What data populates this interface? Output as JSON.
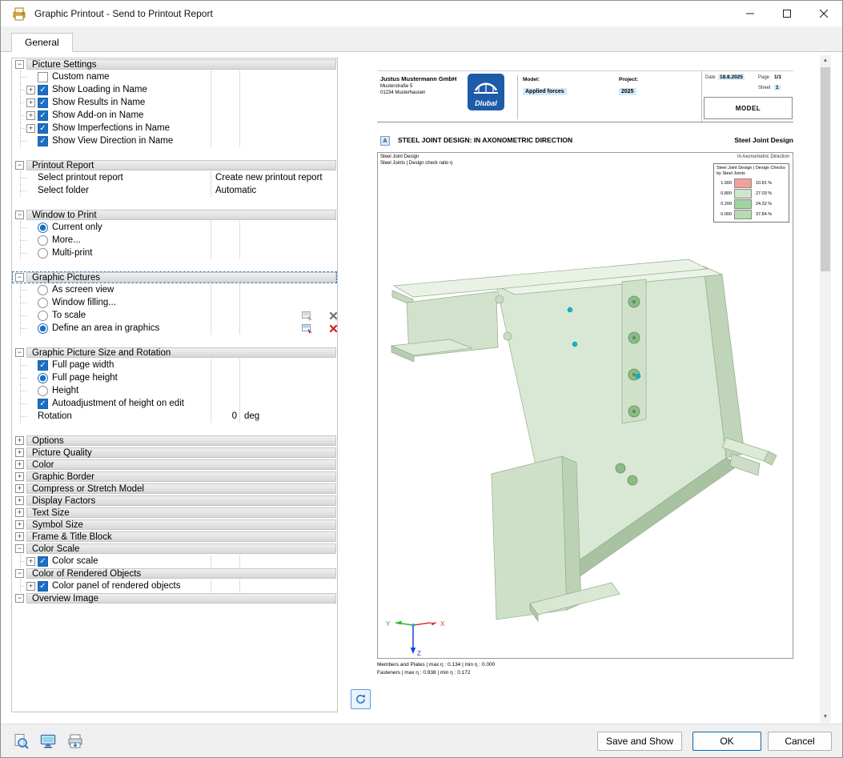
{
  "window": {
    "title": "Graphic Printout - Send to Printout Report"
  },
  "tabs": [
    {
      "label": "General",
      "active": true
    }
  ],
  "colors": {
    "accent_blue": "#1d6fc2",
    "chip_blue": "#d3eaf9",
    "model_green": "#d9e8d4",
    "focus_dashed": "#4a7fb5"
  },
  "icons": {
    "app": "graphic-printout-icon",
    "window": [
      "minimize-icon",
      "maximize-icon",
      "close-icon"
    ],
    "tree_row_icons": [
      "select-area-icon",
      "clear-selection-icon"
    ],
    "preview": "refresh-icon",
    "footer": [
      "print-preview-icon",
      "display-options-icon",
      "save-printer-icon"
    ]
  },
  "tree": {
    "rows": [
      {
        "t": "section",
        "label": "Picture Settings",
        "toggle": "-"
      },
      {
        "t": "item",
        "label": "Custom name",
        "control": "checkbox",
        "checked": false
      },
      {
        "t": "item",
        "label": "Show Loading in Name",
        "control": "checkbox",
        "checked": true,
        "expand": "+"
      },
      {
        "t": "item",
        "label": "Show Results in Name",
        "control": "checkbox",
        "checked": true,
        "expand": "+"
      },
      {
        "t": "item",
        "label": "Show Add-on in Name",
        "control": "checkbox",
        "checked": true,
        "expand": "+"
      },
      {
        "t": "item",
        "label": "Show Imperfections in Name",
        "control": "checkbox",
        "checked": true,
        "expand": "+"
      },
      {
        "t": "item",
        "label": "Show View Direction in Name",
        "control": "checkbox",
        "checked": true
      },
      {
        "t": "gap"
      },
      {
        "t": "section",
        "label": "Printout Report",
        "toggle": "-"
      },
      {
        "t": "item",
        "label": "Select printout report",
        "value": "Create new printout report",
        "wide": true
      },
      {
        "t": "item",
        "label": "Select folder",
        "value": "Automatic",
        "wide": true
      },
      {
        "t": "gap"
      },
      {
        "t": "section",
        "label": "Window to Print",
        "toggle": "-"
      },
      {
        "t": "item",
        "label": "Current only",
        "control": "radio",
        "checked": true
      },
      {
        "t": "item",
        "label": "More...",
        "control": "radio",
        "checked": false
      },
      {
        "t": "item",
        "label": "Multi-print",
        "control": "radio",
        "checked": false
      },
      {
        "t": "gap"
      },
      {
        "t": "section",
        "label": "Graphic Pictures",
        "toggle": "-",
        "focused": true
      },
      {
        "t": "item",
        "label": "As screen view",
        "control": "radio",
        "checked": false
      },
      {
        "t": "item",
        "label": "Window filling...",
        "control": "radio",
        "checked": false
      },
      {
        "t": "item",
        "label": "To scale",
        "control": "radio",
        "checked": false,
        "icons": "disabled"
      },
      {
        "t": "item",
        "label": "Define an area in graphics",
        "control": "radio",
        "checked": true,
        "icons": "enabled"
      },
      {
        "t": "gap"
      },
      {
        "t": "section",
        "label": "Graphic Picture Size and Rotation",
        "toggle": "-"
      },
      {
        "t": "item",
        "label": "Full page width",
        "control": "checkbox",
        "checked": true
      },
      {
        "t": "item",
        "label": "Full page height",
        "control": "radio",
        "checked": true
      },
      {
        "t": "item",
        "label": "Height",
        "control": "radio",
        "checked": false
      },
      {
        "t": "item",
        "label": "Autoadjustment of height on edit",
        "control": "checkbox",
        "checked": true
      },
      {
        "t": "item",
        "label": "Rotation",
        "value": "0",
        "unit": "deg"
      },
      {
        "t": "gap"
      },
      {
        "t": "section",
        "label": "Options",
        "toggle": "+"
      },
      {
        "t": "section",
        "label": "Picture Quality",
        "toggle": "+"
      },
      {
        "t": "section",
        "label": "Color",
        "toggle": "+"
      },
      {
        "t": "section",
        "label": "Graphic Border",
        "toggle": "+"
      },
      {
        "t": "section",
        "label": "Compress or Stretch Model",
        "toggle": "+"
      },
      {
        "t": "section",
        "label": "Display Factors",
        "toggle": "+"
      },
      {
        "t": "section",
        "label": "Text Size",
        "toggle": "+"
      },
      {
        "t": "section",
        "label": "Symbol Size",
        "toggle": "+"
      },
      {
        "t": "section",
        "label": "Frame & Title Block",
        "toggle": "+"
      },
      {
        "t": "section",
        "label": "Color Scale",
        "toggle": "-"
      },
      {
        "t": "item",
        "label": "Color scale",
        "control": "checkbox",
        "checked": true,
        "expand": "+"
      },
      {
        "t": "section",
        "label": "Color of Rendered Objects",
        "toggle": "-"
      },
      {
        "t": "item",
        "label": "Color panel of rendered objects",
        "control": "checkbox",
        "checked": true,
        "expand": "+"
      },
      {
        "t": "section",
        "label": "Overview Image",
        "toggle": "-"
      }
    ]
  },
  "preview": {
    "company": {
      "name": "Justus Mustermann GmbH",
      "address1": "Musterstraße 5",
      "address2": "01234 Musterhausen"
    },
    "logo_text": "Dlubal",
    "header": {
      "model_label": "Model:",
      "model_value": "Applied forces",
      "project_label": "Project:",
      "project_value": "2025",
      "date_label": "Date",
      "date_value": "18.8.2025",
      "page_label": "Page",
      "page_value": "1/1",
      "sheet_label": "Sheet",
      "sheet_value": "1",
      "doc_type": "MODEL"
    },
    "section": {
      "marker": "A",
      "title": "STEEL JOINT DESIGN: IN AXONOMETRIC DIRECTION",
      "title_right": "Steel Joint Design",
      "subtitle_right": "In Axonometric Direction",
      "sub1": "Steel Joint Design",
      "sub2": "Steel Joints | Design check ratio η"
    },
    "legend": {
      "title_line1": "Steel Joint Design | Design Checks",
      "title_line2": "by Steel Joints",
      "entries": [
        {
          "value": "1.000",
          "color": "#f2a09b",
          "pct": "10.81 %"
        },
        {
          "value": "0.800",
          "color": "#cde7ca",
          "pct": "27.03 %"
        },
        {
          "value": "0.200",
          "color": "#9fd49c",
          "pct": "24.32 %"
        },
        {
          "value": "0.000",
          "color": "#b4dcb0",
          "pct": "37.84 %"
        }
      ]
    },
    "axes": {
      "x": "X",
      "y": "Y",
      "z": "Z"
    },
    "stats": [
      "Members and Plates | max η : 0.134 | min η : 0.000",
      "Fasteners | max η : 0.938 | min η : 0.172"
    ]
  },
  "footer": {
    "save_show": "Save and Show",
    "ok": "OK",
    "cancel": "Cancel"
  }
}
